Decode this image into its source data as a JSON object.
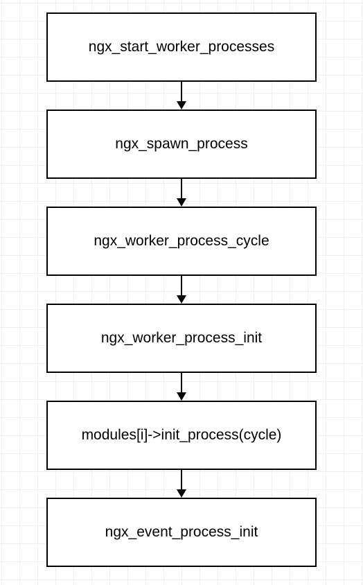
{
  "diagram": {
    "type": "flowchart",
    "direction": "top-to-bottom",
    "nodes": [
      {
        "id": "n1",
        "label": "ngx_start_worker_processes"
      },
      {
        "id": "n2",
        "label": "ngx_spawn_process"
      },
      {
        "id": "n3",
        "label": "ngx_worker_process_cycle"
      },
      {
        "id": "n4",
        "label": "ngx_worker_process_init"
      },
      {
        "id": "n5",
        "label": "modules[i]->init_process(cycle)"
      },
      {
        "id": "n6",
        "label": "ngx_event_process_init"
      }
    ],
    "edges": [
      {
        "from": "n1",
        "to": "n2"
      },
      {
        "from": "n2",
        "to": "n3"
      },
      {
        "from": "n3",
        "to": "n4"
      },
      {
        "from": "n4",
        "to": "n5"
      },
      {
        "from": "n5",
        "to": "n6"
      }
    ]
  }
}
